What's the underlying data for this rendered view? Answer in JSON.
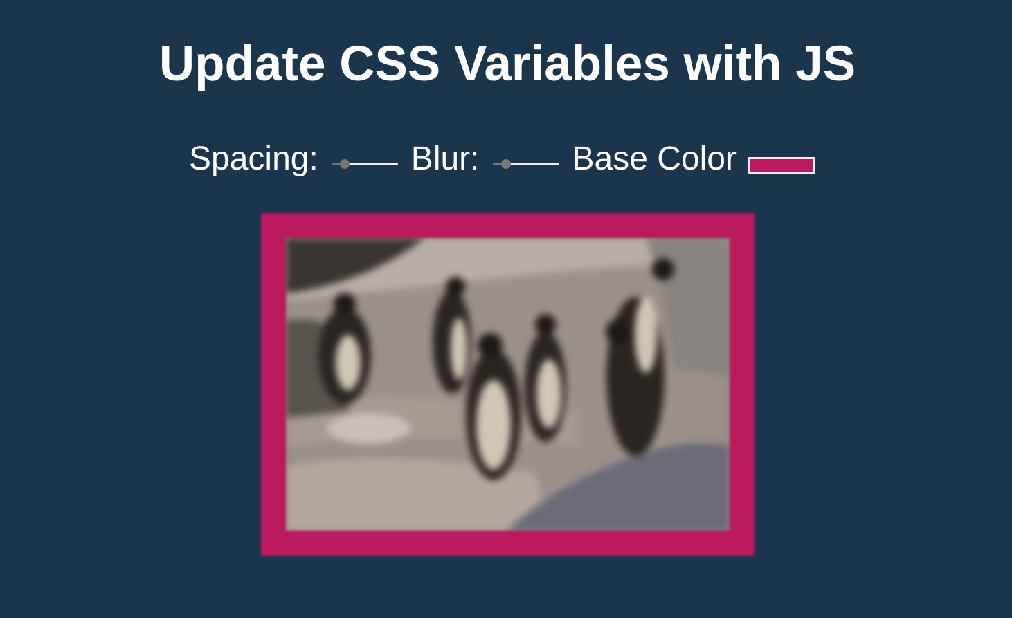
{
  "header": {
    "title": "Update CSS Variables with JS"
  },
  "controls": {
    "spacing": {
      "label": "Spacing:",
      "value_fraction": 0.2
    },
    "blur": {
      "label": "Blur:",
      "value_fraction": 0.2
    },
    "base_color": {
      "label": "Base Color",
      "value": "#bb1a5e"
    }
  },
  "colors": {
    "background": "#1b354d",
    "base": "#bb1a5e",
    "slider_track": "#efefef",
    "slider_thumb": "#777777"
  }
}
